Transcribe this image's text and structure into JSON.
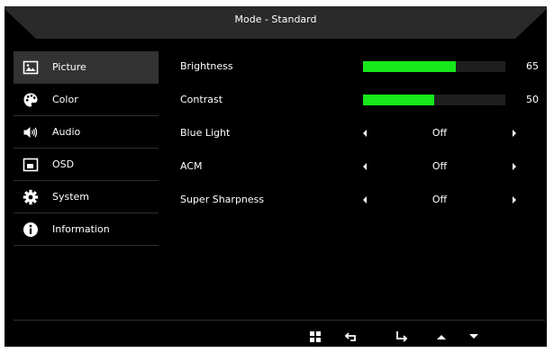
{
  "header": {
    "title": "Mode - Standard"
  },
  "sidebar": {
    "items": [
      {
        "label": "Picture",
        "icon": "picture-icon",
        "selected": true
      },
      {
        "label": "Color",
        "icon": "palette-icon",
        "selected": false
      },
      {
        "label": "Audio",
        "icon": "speaker-icon",
        "selected": false
      },
      {
        "label": "OSD",
        "icon": "osd-icon",
        "selected": false
      },
      {
        "label": "System",
        "icon": "gear-icon",
        "selected": false
      },
      {
        "label": "Information",
        "icon": "info-icon",
        "selected": false
      }
    ]
  },
  "settings": {
    "brightness": {
      "label": "Brightness",
      "value": "65",
      "level": 0.65
    },
    "contrast": {
      "label": "Contrast",
      "value": "50",
      "level": 0.5
    },
    "blue_light": {
      "label": "Blue Light",
      "value": "Off"
    },
    "acm": {
      "label": "ACM",
      "value": "Off"
    },
    "super_sharpness": {
      "label": "Super Sharpness",
      "value": "Off"
    }
  },
  "footer": {
    "buttons": [
      "menu-icon",
      "back-icon",
      "enter-icon",
      "up-arrow-icon",
      "down-arrow-icon"
    ]
  },
  "colors": {
    "background": "#000000",
    "bar_fill": "#17e81b",
    "bar_track": "#1f1f1f",
    "selected_item": "#333333"
  }
}
